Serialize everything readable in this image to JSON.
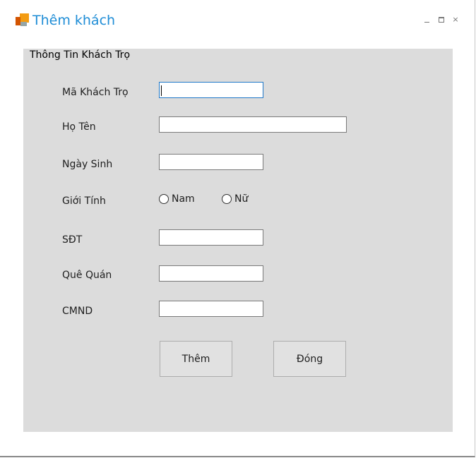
{
  "window": {
    "title": "Thêm khách",
    "icon": "app-logo-icon",
    "controls": [
      "minimize-icon",
      "maximize-icon",
      "close-icon"
    ],
    "close_glyph": "×"
  },
  "group": {
    "title": "Thông Tin Khách Trọ"
  },
  "fields": {
    "ma_khach_tro": {
      "label": "Mã Khách Trọ",
      "value": ""
    },
    "ho_ten": {
      "label": "Họ Tên",
      "value": ""
    },
    "ngay_sinh": {
      "label": "Ngày Sinh",
      "value": ""
    },
    "gioi_tinh": {
      "label": "Giới Tính",
      "options": [
        "Nam",
        "Nữ"
      ],
      "selected": null
    },
    "sdt": {
      "label": "SĐT",
      "value": ""
    },
    "que_quan": {
      "label": "Quê Quán",
      "value": ""
    },
    "cmnd": {
      "label": "CMND",
      "value": ""
    }
  },
  "buttons": {
    "add": "Thêm",
    "close": "Đóng"
  },
  "colors": {
    "title": "#1f8dd6",
    "panel_bg": "#dcdcdc",
    "focus_border": "#1f78c8"
  }
}
